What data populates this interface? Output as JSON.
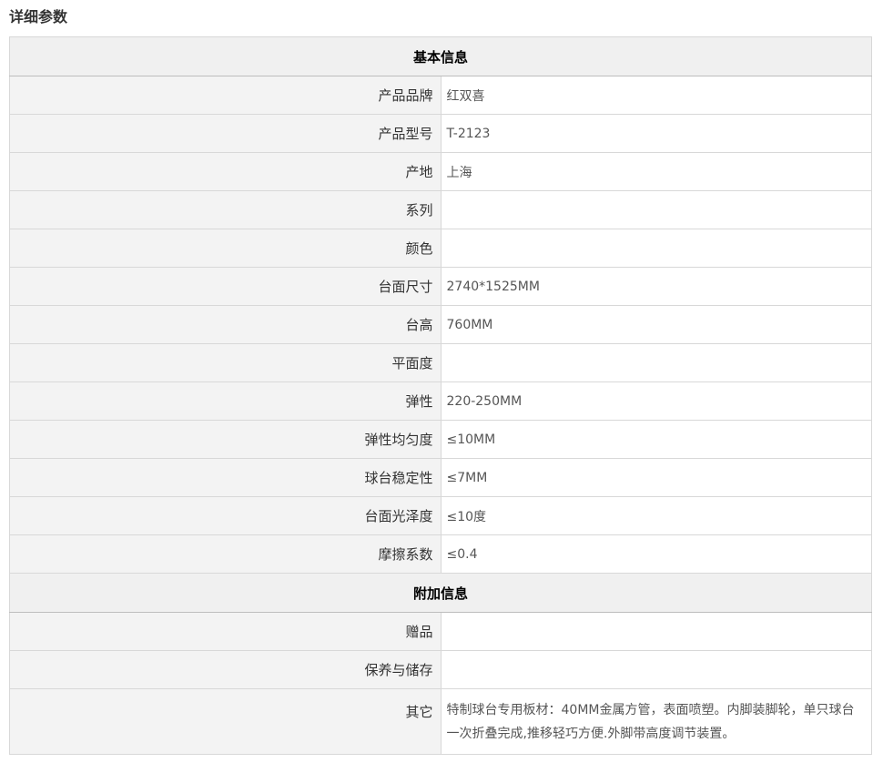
{
  "page_title": "详细参数",
  "sections": [
    {
      "title": "基本信息",
      "rows": [
        {
          "key": "产品品牌",
          "value": "红双喜"
        },
        {
          "key": "产品型号",
          "value": "T-2123"
        },
        {
          "key": "产地",
          "value": "上海"
        },
        {
          "key": "系列",
          "value": ""
        },
        {
          "key": "颜色",
          "value": ""
        },
        {
          "key": "台面尺寸",
          "value": "2740*1525MM"
        },
        {
          "key": "台高",
          "value": "760MM"
        },
        {
          "key": "平面度",
          "value": ""
        },
        {
          "key": "弹性",
          "value": "220-250MM"
        },
        {
          "key": "弹性均匀度",
          "value": "≤10MM"
        },
        {
          "key": "球台稳定性",
          "value": "≤7MM"
        },
        {
          "key": "台面光泽度",
          "value": "≤10度"
        },
        {
          "key": "摩擦系数",
          "value": "≤0.4"
        }
      ]
    },
    {
      "title": "附加信息",
      "rows": [
        {
          "key": "赠品",
          "value": ""
        },
        {
          "key": "保养与储存",
          "value": ""
        },
        {
          "key": "其它",
          "value": "特制球台专用板材：40MM金属方管，表面喷塑。内脚装脚轮，单只球台一次折叠完成,推移轻巧方便.外脚带高度调节装置。"
        }
      ]
    }
  ]
}
